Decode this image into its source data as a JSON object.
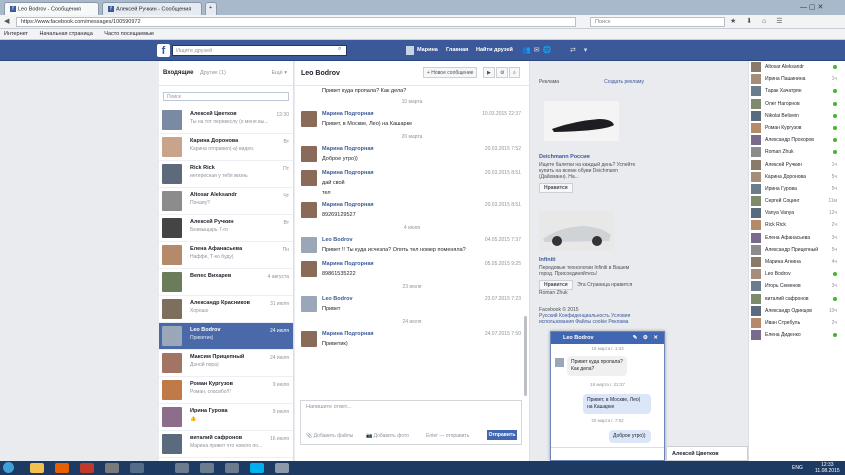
{
  "browser": {
    "tabs": [
      "Leo Bodrov - Сообщения",
      "Алексей Ручкин - Сообщения"
    ],
    "url": "https://www.facebook.com/messages/100590972",
    "search_placeholder": "Поиск",
    "bookmarks": [
      "Интернет",
      "Начальная страница",
      "Часто посещаемые"
    ]
  },
  "fb": {
    "logo": "f",
    "search_placeholder": "Ищите друзей",
    "nav": [
      "Марина",
      "Главная",
      "Найти друзей"
    ]
  },
  "inbox": {
    "tab_inbox": "Входящие",
    "tab_other": "Другие (1)",
    "more": "Ещё ▾",
    "search_placeholder": "Поиск",
    "conversations": [
      {
        "name": "Алексей Цветков",
        "preview": "Ты на тот перевеслу (о меня вы...",
        "time": "12:30",
        "color": "#7a8aa3"
      },
      {
        "name": "Карина Доронова",
        "preview": "Карина отправил(-а) видео.",
        "time": "Вт",
        "color": "#c9a38a"
      },
      {
        "name": "Rick Rick",
        "preview": "интересная у тебя жизнь",
        "time": "Пт",
        "color": "#5d6a7c"
      },
      {
        "name": "Altosar Aleksandr",
        "preview": "Понаяу?",
        "time": "Чт",
        "color": "#8c8c8c"
      },
      {
        "name": "Алексей Ручкин",
        "preview": "Безмыщарь 7-го",
        "time": "Вт",
        "color": "#444"
      },
      {
        "name": "Елена Афанасьева",
        "preview": "Наффе, Т-ко буду)",
        "time": "Пн",
        "color": "#b58a6b"
      },
      {
        "name": "Вепес Вихарев",
        "preview": "",
        "time": "4 августа",
        "color": "#6b7c5a"
      },
      {
        "name": "Александр Красников",
        "preview": "Хорошо",
        "time": "31 июля",
        "color": "#7d6e5d"
      },
      {
        "name": "Leo Bodrov",
        "preview": "Приветик)",
        "time": "24 июля",
        "color": "#9aa7b8"
      },
      {
        "name": "Максим Прицепный",
        "preview": "Доной пора)",
        "time": "24 июля",
        "color": "#a37463"
      },
      {
        "name": "Роман Кургузов",
        "preview": "Роман, спасибо!!!",
        "time": "9 июля",
        "color": "#c07a4a"
      },
      {
        "name": "Ирина Гурова",
        "preview": "👍",
        "time": "9 июля",
        "color": "#8c6d8a"
      },
      {
        "name": "виталий сафронов",
        "preview": "Марина привет что нового по...",
        "time": "16 июля",
        "color": "#5a6b7d"
      }
    ]
  },
  "thread": {
    "title": "Leo Bodrov",
    "new_message": "+ Новое сообщение",
    "top_text": "Привет куда пропала? Как дела?",
    "items": [
      {
        "kind": "sep",
        "text": "10 марта"
      },
      {
        "kind": "msg",
        "name": "Марина Подгорная",
        "text": "Привет, в Москве, Лео) на Кашарке",
        "time": "10.03.2015 22:37",
        "color": "#8a6b5a"
      },
      {
        "kind": "sep",
        "text": "20 марта"
      },
      {
        "kind": "msg",
        "name": "Марина Подгорная",
        "text": "Доброе утро))",
        "time": "20.03.2015 7:52",
        "color": "#8a6b5a"
      },
      {
        "kind": "msg",
        "name": "Марина Подгорная",
        "text": "дай свой",
        "time": "20.03.2015 8:51",
        "color": "#8a6b5a"
      },
      {
        "kind": "plain",
        "text": "тел"
      },
      {
        "kind": "msg",
        "name": "Марина Подгорная",
        "text": "89269129527",
        "time": "20.03.2015 8:51",
        "color": "#8a6b5a"
      },
      {
        "kind": "sep",
        "text": "4 июля"
      },
      {
        "kind": "msg",
        "name": "Leo Bodrov",
        "text": "Привет !! Ты куда исчезла? Опять тел номер поменяла?",
        "time": "04.05.2015 7:37",
        "color": "#9aa7b8"
      },
      {
        "kind": "msg",
        "name": "Марина Подгорная",
        "text": "89861535222",
        "time": "05.05.2015 9:25",
        "color": "#8a6b5a"
      },
      {
        "kind": "sep",
        "text": "23 июля"
      },
      {
        "kind": "msg",
        "name": "Leo Bodrov",
        "text": "Привет",
        "time": "23.07.2015 7:23",
        "color": "#9aa7b8"
      },
      {
        "kind": "sep",
        "text": "24 июля"
      },
      {
        "kind": "msg",
        "name": "Марина Подгорная",
        "text": "Приветик)",
        "time": "24.07.2015 7:50",
        "color": "#8a6b5a"
      }
    ],
    "compose_placeholder": "Напишите ответ...",
    "add_files": "Добавить файлы",
    "add_photo": "Добавить фото",
    "enter_send": "Enter — отправить",
    "send": "Отправить"
  },
  "ads": {
    "header": "Реклама",
    "create": "Создать рекламу",
    "ad1_title": "Deichmann Россия",
    "ad1_text": "Ищете балетки на каждый день? Успейте купить на всемн обуви Deichmann (Дайхманн). На...",
    "ad2_title": "Infiniti",
    "ad2_text": "Передовые технологии Infiniti в Вашем город. Присоединяйтесь!",
    "ad2_like": "Эта Страница нравится Roman Zhuk",
    "like": "Нравится",
    "footer_copy": "Facebook © 2015",
    "footer_links": "Русский Конфиденциальность Условия использования Файлы cookie Реклама"
  },
  "chatwin": {
    "name": "Leo Bodrov",
    "date1": "19 марта г. 1:33",
    "in_msg": "Привет куда пропала? Как дела?",
    "date2": "19 марта г. 22:37",
    "out_msg": "Привет, в Москве, Лео) на Кашарке",
    "date3": "20 марта г. 7:52",
    "out_msg2": "Доброе утро))",
    "bottom_name": "Алексей Цветков"
  },
  "chat_sidebar": [
    {
      "name": "Altosar Aleksandr",
      "status": "online"
    },
    {
      "name": "Ирина Пашинина",
      "status": "1ч"
    },
    {
      "name": "Тарак Хачатрян",
      "status": "online"
    },
    {
      "name": "Олег Нагорнов",
      "status": "online"
    },
    {
      "name": "Nikolai Belivein",
      "status": "online"
    },
    {
      "name": "Роман Кургузов",
      "status": "online"
    },
    {
      "name": "Александр Прохоров",
      "status": "online"
    },
    {
      "name": "Roman Zhuk",
      "status": "online"
    },
    {
      "name": "Алексей Ручкин",
      "status": "1ч"
    },
    {
      "name": "Карина Доронова",
      "status": "5ч"
    },
    {
      "name": "Ирина Гурова",
      "status": "5ч"
    },
    {
      "name": "Сергей Социнг",
      "status": "11м"
    },
    {
      "name": "Vanya Vanya",
      "status": "12ч"
    },
    {
      "name": "Rick Rick",
      "status": "2ч"
    },
    {
      "name": "Елена Афанасьева",
      "status": "3ч"
    },
    {
      "name": "Александр Прицепный",
      "status": "5ч"
    },
    {
      "name": "Марина Агнина",
      "status": "4ч"
    },
    {
      "name": "Leo Bodrov",
      "status": "online"
    },
    {
      "name": "Игорь Семенов",
      "status": "3ч"
    },
    {
      "name": "виталий сафронов",
      "status": "online"
    },
    {
      "name": "Александр Одинцов",
      "status": "10ч"
    },
    {
      "name": "Иван Стребуль",
      "status": "2ч"
    },
    {
      "name": "Елена Диденко",
      "status": "online"
    }
  ],
  "taskbar": {
    "lang": "ENG",
    "time": "12:33",
    "date": "11.08.2015"
  }
}
